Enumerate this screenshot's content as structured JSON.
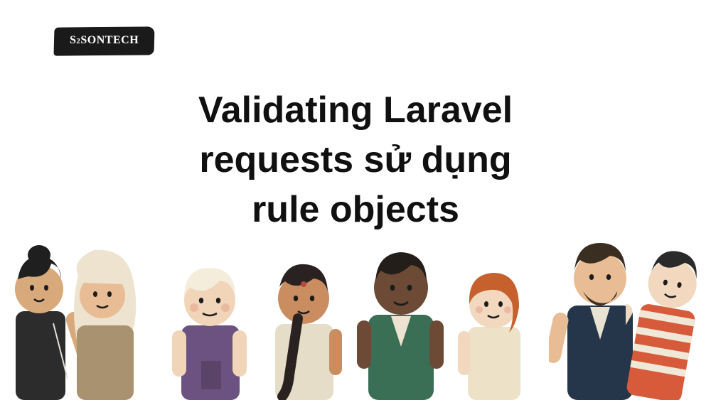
{
  "logo": {
    "text_prefix": "S",
    "text_sub": "2",
    "text_suffix": "SONTECH"
  },
  "title": {
    "line1": "Validating Laravel",
    "line2": "requests sử dụng",
    "line3": "rule objects"
  },
  "people": [
    {
      "id": "person-1",
      "skin": "#d8a97a",
      "shirt": "#2c2c2c",
      "hair": "#1f1f1f"
    },
    {
      "id": "person-2",
      "skin": "#e8bd95",
      "shirt": "#a99270",
      "hair": "#4a3a2a",
      "hijab": "#ede3cf"
    },
    {
      "id": "person-3",
      "skin": "#f0d5b8",
      "shirt": "#6b5280",
      "hair": "#f5eddc"
    },
    {
      "id": "person-4",
      "skin": "#c98d60",
      "shirt": "#e5ddc8",
      "hair": "#2a2220"
    },
    {
      "id": "person-5",
      "skin": "#6d4a36",
      "shirt": "#3a6e55",
      "hair": "#241e1a"
    },
    {
      "id": "person-6",
      "skin": "#f1d8be",
      "shirt": "#ede1c7",
      "hair": "#c6602c"
    },
    {
      "id": "person-7",
      "skin": "#e8bd95",
      "shirt": "#25364a",
      "hair": "#3a2e20"
    },
    {
      "id": "person-8",
      "skin": "#f1d8be",
      "shirt": "#d75a3a",
      "hair": "#2a2a2a"
    }
  ]
}
